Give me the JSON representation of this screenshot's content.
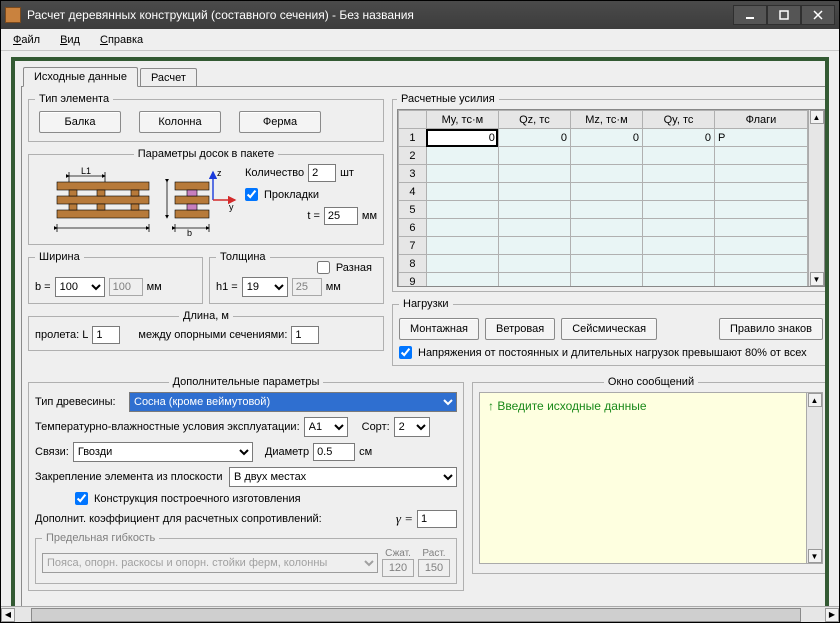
{
  "window": {
    "title": "Расчет деревянных конструкций (составного сечения) - Без названия"
  },
  "menu": {
    "file": "Файл",
    "view": "Вид",
    "help": "Справка"
  },
  "tabs": {
    "input": "Исходные данные",
    "calc": "Расчет"
  },
  "elemType": {
    "legend": "Тип элемента",
    "beam": "Балка",
    "column": "Колонна",
    "truss": "Ферма"
  },
  "boards": {
    "legend": "Параметры досок в пакете",
    "count_label": "Количество",
    "count": "2",
    "count_unit": "шт",
    "gaskets_label": "Прокладки",
    "gaskets_checked": true,
    "t_label": "t =",
    "t": "25",
    "t_unit": "мм",
    "dia_L1": "L1",
    "dia_b": "b",
    "dia_z": "z",
    "dia_y": "y"
  },
  "width": {
    "legend": "Ширина",
    "b_label": "b =",
    "b": "100",
    "b2": "100",
    "unit": "мм"
  },
  "thickness": {
    "legend": "Толщина",
    "diff_label": "Разная",
    "diff_checked": false,
    "h1_label": "h1 =",
    "h1": "19",
    "h2": "25",
    "unit": "мм"
  },
  "length": {
    "legend": "Длина, м",
    "span_label": "пролета: L",
    "span": "1",
    "between_label": "между опорными сечениями:",
    "between": "1"
  },
  "forces": {
    "legend": "Расчетные усилия",
    "headers": [
      "My, тс·м",
      "Qz, тс",
      "Mz, тс·м",
      "Qy, тс",
      "Флаги"
    ],
    "rows": [
      {
        "n": "1",
        "My": "0",
        "Qz": "0",
        "Mz": "0",
        "Qy": "0",
        "F": "P"
      },
      {
        "n": "2"
      },
      {
        "n": "3"
      },
      {
        "n": "4"
      },
      {
        "n": "5"
      },
      {
        "n": "6"
      },
      {
        "n": "7"
      },
      {
        "n": "8"
      },
      {
        "n": "9"
      }
    ]
  },
  "loads": {
    "legend": "Нагрузки",
    "mont": "Монтажная",
    "wind": "Ветровая",
    "seis": "Сейсмическая",
    "signs": "Правило знаков",
    "stress80_label": "Напряжения от постоянных и длительных нагрузок превышают 80% от всех",
    "stress80_checked": true
  },
  "extra": {
    "legend": "Дополнительные параметры",
    "wood_label": "Тип древесины:",
    "wood_value": "Сосна (кроме веймутовой)",
    "temp_label": "Температурно-влажностные условия эксплуатации:",
    "temp_value": "А1",
    "grade_label": "Сорт:",
    "grade_value": "2",
    "links_label": "Связи:",
    "links_value": "Гвозди",
    "diam_label": "Диаметр",
    "diam_value": "0.5",
    "diam_unit": "см",
    "oop_label": "Закрепление элемента из плоскости",
    "oop_value": "В двух местах",
    "onsite_label": "Конструкция построечного изготовления",
    "onsite_checked": true,
    "gamma_label": "Дополнит. коэффициент для расчетных сопротивлений:",
    "gamma_sym": "γ =",
    "gamma_value": "1"
  },
  "slender": {
    "legend": "Предельная гибкость",
    "item": "Пояса, опорн. раскосы и опорн. стойки ферм, колонны",
    "comp_label": "Сжат.",
    "comp": "120",
    "tens_label": "Раст.",
    "tens": "150"
  },
  "messages": {
    "legend": "Окно сообщений",
    "text": "↑ Введите исходные данные"
  }
}
